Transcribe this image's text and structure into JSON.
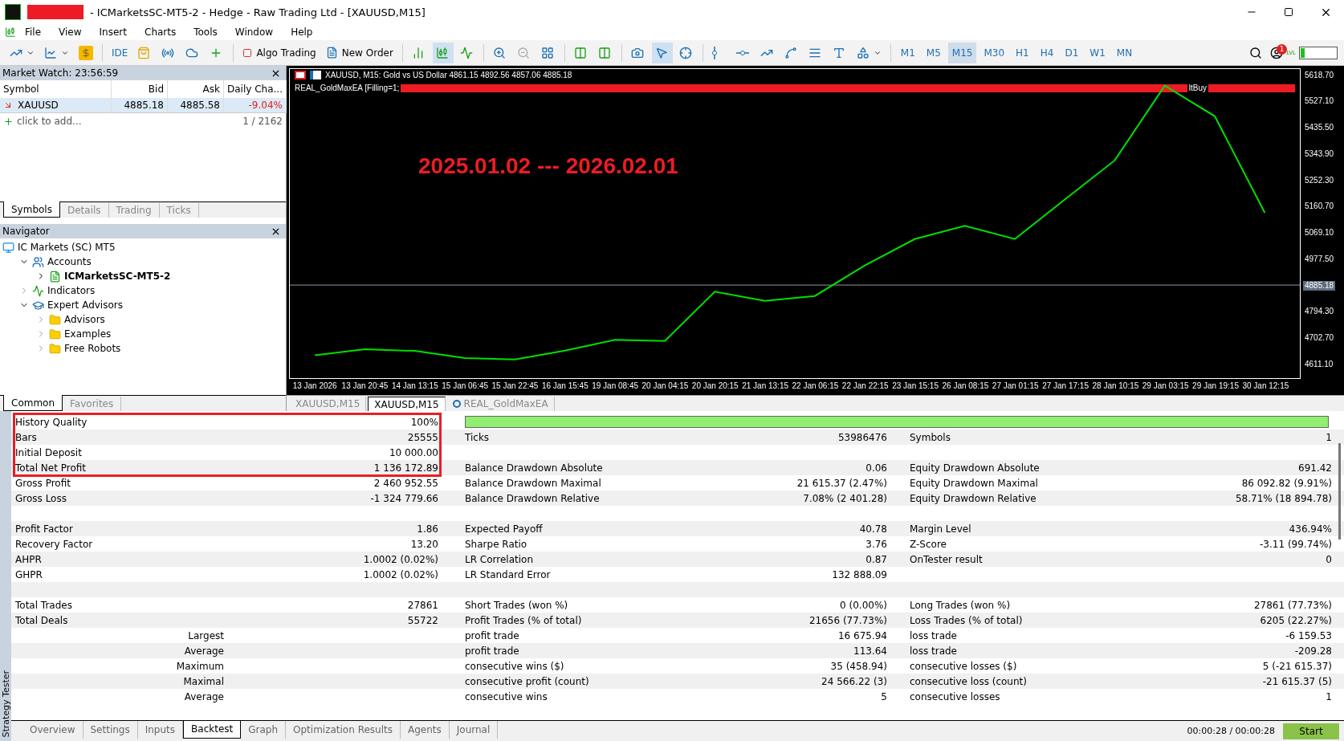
{
  "window": {
    "title": "- ICMarketsSC-MT5-2 - Hedge - Raw Trading Ltd - [XAUUSD,M15]"
  },
  "menu": [
    "File",
    "View",
    "Insert",
    "Charts",
    "Tools",
    "Window",
    "Help"
  ],
  "toolbar": {
    "ide": "IDE",
    "algo_trading": "Algo Trading",
    "new_order": "New Order",
    "timeframes": [
      {
        "label": "M1",
        "selected": false
      },
      {
        "label": "M5",
        "selected": false
      },
      {
        "label": "M15",
        "selected": true
      },
      {
        "label": "M30",
        "selected": false
      },
      {
        "label": "H1",
        "selected": false
      },
      {
        "label": "H4",
        "selected": false
      },
      {
        "label": "D1",
        "selected": false
      },
      {
        "label": "W1",
        "selected": false
      },
      {
        "label": "MN",
        "selected": false
      }
    ],
    "notifications": "1",
    "lvl": "LVL",
    "meter": {
      "level": 0.12
    }
  },
  "market_watch": {
    "title": "Market Watch: 23:56:59",
    "columns": [
      "Symbol",
      "Bid",
      "Ask",
      "Daily Cha..."
    ],
    "rows": [
      {
        "symbol": "XAUUSD",
        "bid": "4885.18",
        "ask": "4885.58",
        "change": "-9.04%",
        "selected": true
      }
    ],
    "add": "click to add...",
    "count": "1 / 2162",
    "tabs": [
      {
        "label": "Symbols",
        "selected": true
      },
      {
        "label": "Details",
        "selected": false
      },
      {
        "label": "Trading",
        "selected": false
      },
      {
        "label": "Ticks",
        "selected": false
      }
    ]
  },
  "navigator": {
    "title": "Navigator",
    "tree": [
      {
        "label": "IC Markets (SC) MT5",
        "kind": "root",
        "children": [
          {
            "label": "Accounts",
            "kind": "accounts",
            "expanded": true,
            "children": [
              {
                "label": "ICMarketsSC-MT5-2",
                "kind": "account",
                "expanded": false
              }
            ]
          },
          {
            "label": "Indicators",
            "kind": "indicators",
            "expanded": false
          },
          {
            "label": "Expert Advisors",
            "kind": "experts",
            "expanded": true,
            "children": [
              {
                "label": "Advisors",
                "kind": "folder",
                "expanded": false
              },
              {
                "label": "Examples",
                "kind": "folder",
                "expanded": false
              },
              {
                "label": "Free Robots",
                "kind": "folder",
                "expanded": false
              }
            ]
          }
        ]
      }
    ],
    "tabs": [
      {
        "label": "Common",
        "selected": true
      },
      {
        "label": "Favorites",
        "selected": false
      }
    ]
  },
  "chart": {
    "header": "XAUUSD, M15:  Gold vs US Dollar  4861.15 4892.56 4857.06 4885.18",
    "ea_label": "REAL_GoldMaxEA [Filling=1;",
    "ea_tail": "ltBuy",
    "period_note": "2025.01.02 --- 2026.02.01",
    "chart_data": {
      "type": "line",
      "categories": [
        "13 Jan 2026",
        "13 Jan 20:45",
        "14 Jan 13:15",
        "15 Jan 06:45",
        "15 Jan 22:45",
        "16 Jan 15:45",
        "19 Jan 08:45",
        "20 Jan 04:15",
        "20 Jan 20:15",
        "21 Jan 13:15",
        "22 Jan 06:15",
        "22 Jan 22:15",
        "23 Jan 15:15",
        "26 Jan 08:15",
        "27 Jan 01:15",
        "27 Jan 17:15",
        "28 Jan 10:15",
        "29 Jan 03:15",
        "29 Jan 19:15",
        "30 Jan 12:15"
      ],
      "series": [
        {
          "color": "#00e000",
          "values": [
            4640,
            4661,
            4655,
            4630,
            4625,
            4656,
            4694,
            4690,
            4862,
            4830,
            4847,
            4954,
            5046,
            5092,
            5046,
            5184,
            5321,
            5582,
            5475,
            5138
          ]
        }
      ],
      "ref_lines": [
        {
          "axis": "y",
          "value": 4885.18,
          "label": "4885.18"
        }
      ],
      "ylim": [
        4560,
        5640
      ],
      "yticks": [
        {
          "value": 4611.1,
          "label": "4611.10"
        },
        {
          "value": 4702.7,
          "label": "4702.70"
        },
        {
          "value": 4794.3,
          "label": "4794.30"
        },
        {
          "value": 4977.5,
          "label": "4977.50"
        },
        {
          "value": 5069.1,
          "label": "5069.10"
        },
        {
          "value": 5160.7,
          "label": "5160.70"
        },
        {
          "value": 5252.3,
          "label": "5252.30"
        },
        {
          "value": 5343.9,
          "label": "5343.90"
        },
        {
          "value": 5435.5,
          "label": "5435.50"
        },
        {
          "value": 5527.1,
          "label": "5527.10"
        },
        {
          "value": 5618.7,
          "label": "5618.70"
        }
      ]
    },
    "tabs": [
      {
        "label": "XAUUSD,M15",
        "selected": false,
        "kind": "chart"
      },
      {
        "label": "XAUUSD,M15",
        "selected": true,
        "kind": "chart"
      },
      {
        "label": "REAL_GoldMaxEA",
        "selected": false,
        "kind": "ea"
      }
    ]
  },
  "report": {
    "side_label": "Strategy Tester",
    "highlighted_rows": [
      {
        "kind": "quality",
        "cells": [
          {
            "label": "History Quality",
            "value": "100%",
            "level": 1
          }
        ]
      },
      {
        "kind": "metric",
        "cells": [
          {
            "label": "Bars",
            "value": "25555"
          },
          {
            "label": "Ticks",
            "value": "53986476"
          },
          {
            "label": "Symbols",
            "value": "1"
          }
        ]
      },
      {
        "kind": "metric",
        "cells": [
          {
            "label": "Initial Deposit",
            "value": "10 000.00"
          }
        ]
      },
      {
        "kind": "metric",
        "cells": [
          {
            "label": "Total Net Profit",
            "value": "1 136 172.89"
          },
          {
            "label": "Balance Drawdown Absolute",
            "value": "0.06"
          },
          {
            "label": "Equity Drawdown Absolute",
            "value": "691.42"
          }
        ]
      }
    ],
    "rows": [
      {
        "kind": "metric",
        "cells": [
          {
            "label": "Gross Profit",
            "value": "2 460 952.55"
          },
          {
            "label": "Balance Drawdown Maximal",
            "value": "21 615.37 (2.47%)"
          },
          {
            "label": "Equity Drawdown Maximal",
            "value": "86 092.82 (9.91%)"
          }
        ]
      },
      {
        "kind": "metric",
        "cells": [
          {
            "label": "Gross Loss",
            "value": "-1 324 779.66"
          },
          {
            "label": "Balance Drawdown Relative",
            "value": "7.08% (2 401.28)"
          },
          {
            "label": "Equity Drawdown Relative",
            "value": "58.71% (18 894.78)"
          }
        ]
      },
      {
        "kind": "spacer",
        "cells": []
      },
      {
        "kind": "metric",
        "cells": [
          {
            "label": "Profit Factor",
            "value": "1.86"
          },
          {
            "label": "Expected Payoff",
            "value": "40.78"
          },
          {
            "label": "Margin Level",
            "value": "436.94%"
          }
        ]
      },
      {
        "kind": "metric",
        "cells": [
          {
            "label": "Recovery Factor",
            "value": "13.20"
          },
          {
            "label": "Sharpe Ratio",
            "value": "3.76"
          },
          {
            "label": "Z-Score",
            "value": "-3.11 (99.74%)"
          }
        ]
      },
      {
        "kind": "metric",
        "cells": [
          {
            "label": "AHPR",
            "value": "1.0002 (0.02%)"
          },
          {
            "label": "LR Correlation",
            "value": "0.87"
          },
          {
            "label": "OnTester result",
            "value": "0"
          }
        ]
      },
      {
        "kind": "metric",
        "cells": [
          {
            "label": "GHPR",
            "value": "1.0002 (0.02%)"
          },
          {
            "label": "LR Standard Error",
            "value": "132 888.09"
          }
        ]
      },
      {
        "kind": "spacer",
        "cells": []
      },
      {
        "kind": "metric",
        "cells": [
          {
            "label": "Total Trades",
            "value": "27861"
          },
          {
            "label": "Short Trades (won %)",
            "value": "0 (0.00%)"
          },
          {
            "label": "Long Trades (won %)",
            "value": "27861 (77.73%)"
          }
        ]
      },
      {
        "kind": "metric",
        "cells": [
          {
            "label": "Total Deals",
            "value": "55722"
          },
          {
            "label": "Profit Trades (% of total)",
            "value": "21656 (77.73%)"
          },
          {
            "label": "Loss Trades (% of total)",
            "value": "6205 (22.27%)"
          }
        ]
      },
      {
        "kind": "split",
        "cells": [
          {
            "label": "Largest"
          },
          {
            "label": "profit trade",
            "value": "16 675.94"
          },
          {
            "label": "loss trade",
            "value": "-6 159.53"
          }
        ]
      },
      {
        "kind": "split",
        "cells": [
          {
            "label": "Average"
          },
          {
            "label": "profit trade",
            "value": "113.64"
          },
          {
            "label": "loss trade",
            "value": "-209.28"
          }
        ]
      },
      {
        "kind": "split",
        "cells": [
          {
            "label": "Maximum"
          },
          {
            "label": "consecutive wins ($)",
            "value": "35 (458.94)"
          },
          {
            "label": "consecutive losses ($)",
            "value": "5 (-21 615.37)"
          }
        ]
      },
      {
        "kind": "split",
        "cells": [
          {
            "label": "Maximal"
          },
          {
            "label": "consecutive profit (count)",
            "value": "24 566.22 (3)"
          },
          {
            "label": "consecutive loss (count)",
            "value": "-21 615.37 (5)"
          }
        ]
      },
      {
        "kind": "split",
        "cells": [
          {
            "label": "Average"
          },
          {
            "label": "consecutive wins",
            "value": "5"
          },
          {
            "label": "consecutive losses",
            "value": "1"
          }
        ]
      }
    ],
    "tabs": [
      {
        "label": "Overview",
        "selected": false
      },
      {
        "label": "Settings",
        "selected": false
      },
      {
        "label": "Inputs",
        "selected": false
      },
      {
        "label": "Backtest",
        "selected": true
      },
      {
        "label": "Graph",
        "selected": false
      },
      {
        "label": "Optimization Results",
        "selected": false
      },
      {
        "label": "Agents",
        "selected": false
      },
      {
        "label": "Journal",
        "selected": false
      }
    ],
    "elapsed": "00:00:28 / 00:00:28",
    "start": "Start"
  }
}
